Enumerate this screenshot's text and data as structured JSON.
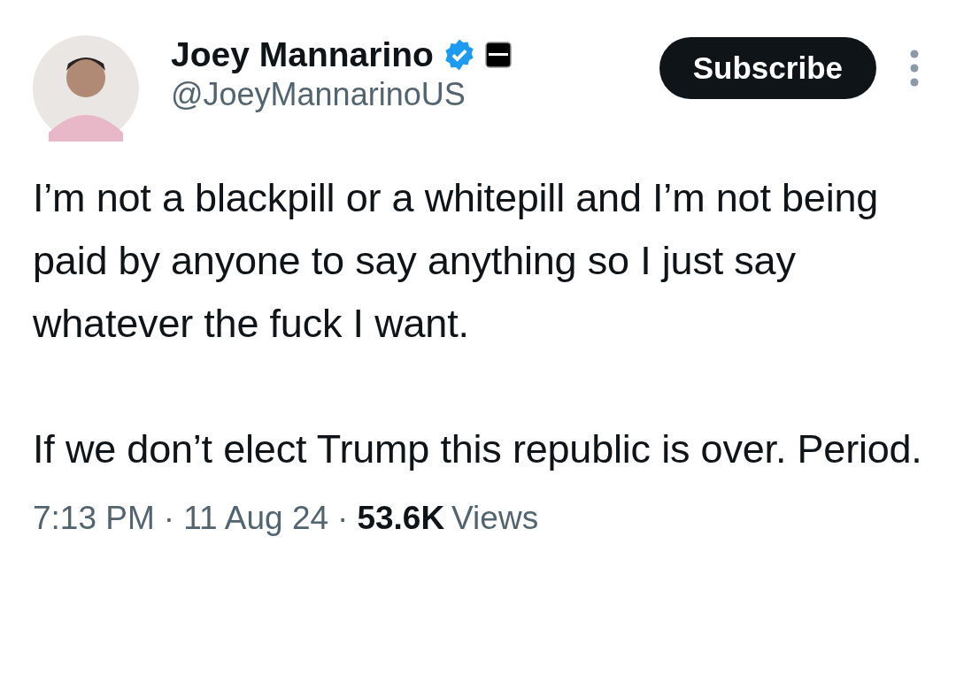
{
  "author": {
    "name": "Joey Mannarino",
    "verified": true,
    "affiliate": true,
    "handle": "@JoeyMannarinoUS"
  },
  "subscribe_button": "Subscribe",
  "paragraphs": [
    "I’m not a blackpill or a whitepill and I’m not being paid by anyone to say anything so I just say whatever the fuck I want.",
    "If we don’t elect Trump this republic is over. Period."
  ],
  "meta": [
    {
      "kind": "time",
      "text": "7:13 PM"
    },
    {
      "kind": "separator",
      "text": "·"
    },
    {
      "kind": "date",
      "text": "11 Aug 24"
    },
    {
      "kind": "separator",
      "text": "·"
    },
    {
      "kind": "count",
      "text": "53.6K"
    },
    {
      "kind": "label",
      "text": "Views"
    }
  ]
}
